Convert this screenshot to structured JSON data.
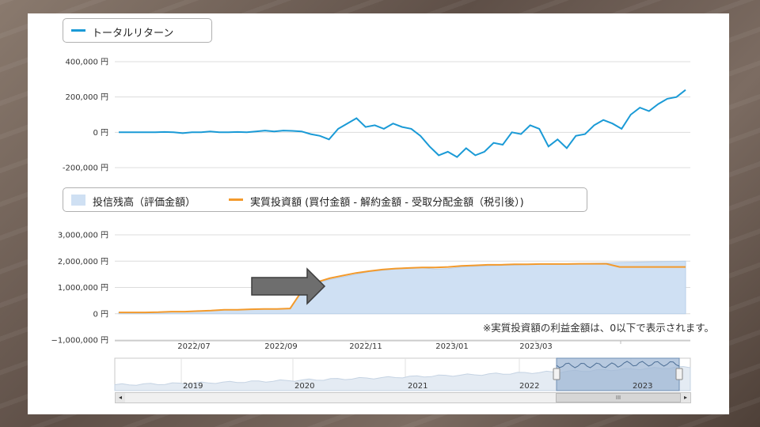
{
  "legend_top": {
    "label": "トータルリターン",
    "color": "#1a9ad6"
  },
  "legend_bottom": {
    "area_label": "投信残高（評価金額）",
    "area_color": "#cfe0f3",
    "line_label": "実質投資額 (買付金額 - 解約金額 - 受取分配金額（税引後）)",
    "line_color": "#f39a2c"
  },
  "note": "※実質投資額の利益金額は、0以下で表示されます。",
  "x_ticks": [
    "2022/07",
    "2022/09",
    "2022/11",
    "2023/01",
    "2023/03"
  ],
  "navigator": {
    "year_labels": [
      "2019",
      "2020",
      "2021",
      "2022",
      "2023"
    ],
    "window_start": "2022",
    "window_end": "2023"
  },
  "scrollbar": {
    "left_arrow": "◂",
    "right_arrow": "▸",
    "thumb_grip": "III"
  },
  "chart_data": [
    {
      "type": "line",
      "series": [
        {
          "name": "トータルリターン",
          "values": [
            0,
            0,
            0,
            0,
            0,
            2000,
            0,
            -5000,
            0,
            0,
            5000,
            0,
            0,
            2000,
            0,
            5000,
            10000,
            5000,
            10000,
            8000,
            5000,
            -10000,
            -20000,
            -40000,
            20000,
            50000,
            80000,
            30000,
            40000,
            20000,
            50000,
            30000,
            20000,
            -20000,
            -80000,
            -130000,
            -110000,
            -140000,
            -90000,
            -130000,
            -110000,
            -60000,
            -70000,
            0,
            -10000,
            40000,
            20000,
            -80000,
            -40000,
            -90000,
            -20000,
            -10000,
            40000,
            70000,
            50000,
            20000,
            100000,
            140000,
            120000,
            160000,
            190000,
            200000,
            240000
          ]
        }
      ],
      "yticks": [
        400000,
        200000,
        0,
        -200000
      ],
      "ytick_labels": [
        "400,000 円",
        "200,000 円",
        "0 円",
        "-200,000 円"
      ],
      "ylim": [
        -200000,
        400000
      ]
    },
    {
      "type": "area",
      "series": [
        {
          "name": "投信残高（評価金額）",
          "values": [
            50000,
            50000,
            50000,
            60000,
            80000,
            80000,
            100000,
            120000,
            150000,
            150000,
            170000,
            180000,
            180000,
            200000,
            900000,
            1150000,
            1300000,
            1400000,
            1500000,
            1600000,
            1650000,
            1700000,
            1720000,
            1750000,
            1700000,
            1720000,
            1780000,
            1800000,
            1820000,
            1840000,
            1850000,
            1870000,
            1900000,
            1880000,
            1900000,
            1910000,
            1920000,
            1930000,
            1950000,
            1960000,
            1970000,
            1980000,
            1990000,
            2000000
          ]
        },
        {
          "name": "実質投資額 (買付金額 - 解約金額 - 受取分配金額（税引後）)",
          "values": [
            50000,
            50000,
            50000,
            60000,
            80000,
            80000,
            100000,
            120000,
            150000,
            150000,
            170000,
            180000,
            180000,
            200000,
            950000,
            1200000,
            1350000,
            1450000,
            1550000,
            1620000,
            1680000,
            1720000,
            1740000,
            1760000,
            1760000,
            1780000,
            1820000,
            1840000,
            1860000,
            1860000,
            1880000,
            1880000,
            1890000,
            1890000,
            1890000,
            1900000,
            1900000,
            1900000,
            1780000,
            1780000,
            1780000,
            1780000,
            1780000,
            1780000
          ]
        }
      ],
      "yticks": [
        3000000,
        2000000,
        1000000,
        0,
        -1000000
      ],
      "ytick_labels": [
        "3,000,000 円",
        "2,000,000 円",
        "1,000,000 円",
        "0 円",
        "−1,000,000 円"
      ],
      "ylim": [
        -1000000,
        3000000
      ]
    }
  ]
}
